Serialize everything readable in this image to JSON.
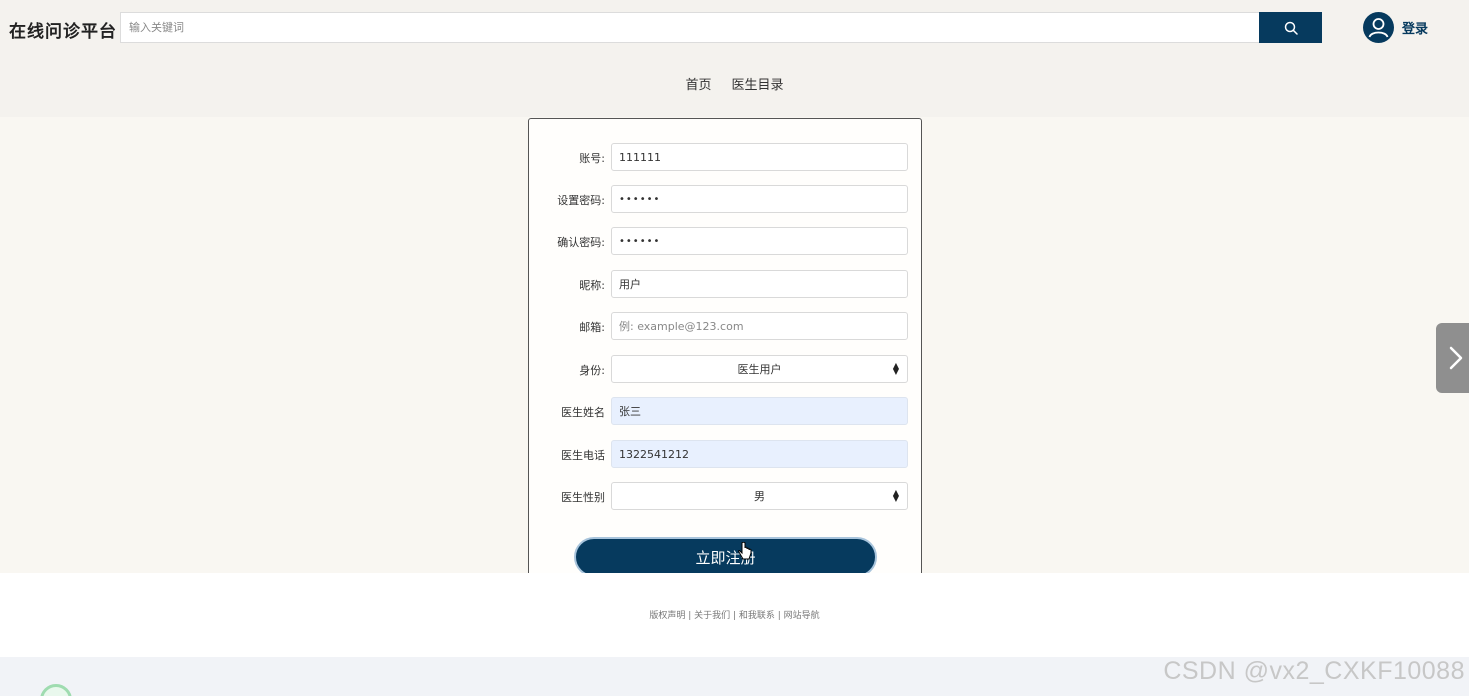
{
  "header": {
    "logo": "在线问诊平台",
    "search_placeholder": "输入关键词",
    "login_label": "登录"
  },
  "nav": {
    "items": [
      "首页",
      "医生目录"
    ]
  },
  "form": {
    "account": {
      "label": "账号:",
      "value": "111111"
    },
    "password": {
      "label": "设置密码:",
      "value": "••••••"
    },
    "confirm_password": {
      "label": "确认密码:",
      "value": "••••••"
    },
    "nickname": {
      "label": "昵称:",
      "value": "用户"
    },
    "email": {
      "label": "邮箱:",
      "placeholder": "例: example@123.com"
    },
    "role": {
      "label": "身份:",
      "value": "医生用户"
    },
    "doctor_name": {
      "label": "医生姓名",
      "value": "张三"
    },
    "doctor_phone": {
      "label": "医生电话",
      "value": "1322541212"
    },
    "doctor_gender": {
      "label": "医生性别",
      "value": "男"
    },
    "submit_label": "立即注册"
  },
  "footer": {
    "links": [
      "版权声明",
      "关于我们",
      "和我联系",
      "网站导航"
    ],
    "separator": " | "
  },
  "watermark": "CSDN @vx2_CXKF10088",
  "colors": {
    "primary": "#063a5e",
    "header_bg": "#f4f2ee",
    "content_bg": "#f9f7f2",
    "autofill_bg": "#e8f0fe"
  }
}
